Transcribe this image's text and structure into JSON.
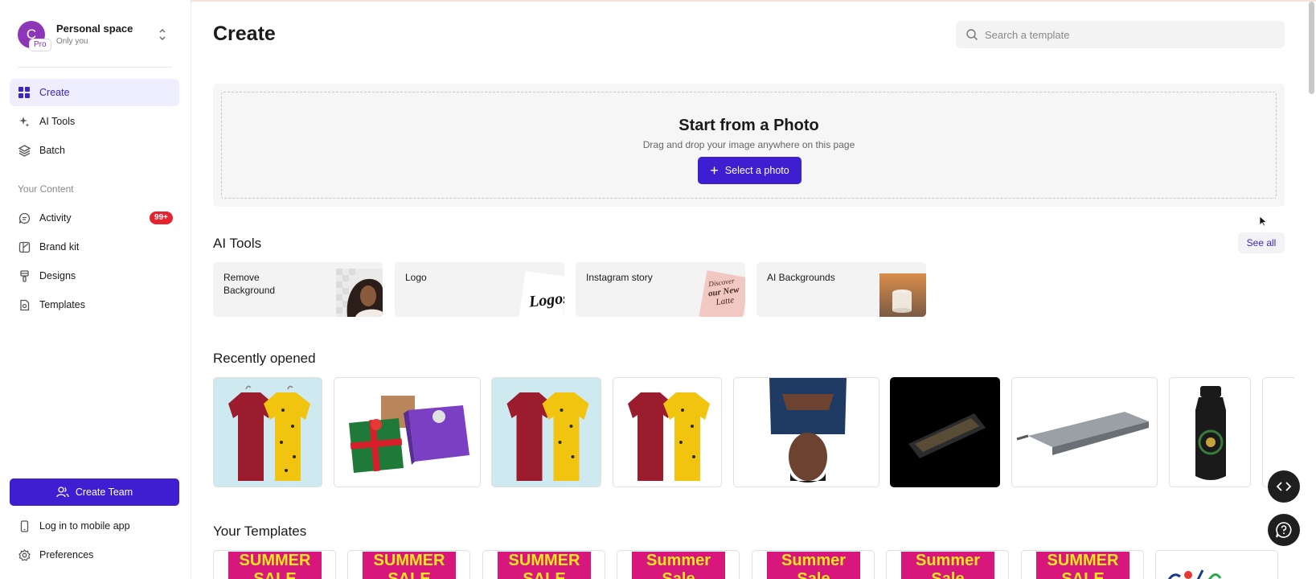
{
  "workspace": {
    "initial": "C",
    "badge": "Pro",
    "name": "Personal space",
    "subtitle": "Only you"
  },
  "sidebar": {
    "items": [
      {
        "label": "Create",
        "icon": "grid-icon"
      },
      {
        "label": "AI Tools",
        "icon": "sparkles-icon"
      },
      {
        "label": "Batch",
        "icon": "layers-icon"
      }
    ],
    "content_label": "Your Content",
    "content_items": [
      {
        "label": "Activity",
        "icon": "chat-icon",
        "badge": "99+"
      },
      {
        "label": "Brand kit",
        "icon": "brand-kit-icon"
      },
      {
        "label": "Designs",
        "icon": "designs-icon"
      },
      {
        "label": "Templates",
        "icon": "template-icon"
      }
    ],
    "create_team": "Create Team",
    "mobile_app": "Log in to mobile app",
    "preferences": "Preferences"
  },
  "header": {
    "title": "Create",
    "search_placeholder": "Search a template"
  },
  "upload": {
    "title": "Start from a Photo",
    "subtitle": "Drag and drop your image anywhere on this page",
    "button": "Select a photo"
  },
  "ai_tools": {
    "heading": "AI Tools",
    "see_all": "See all",
    "cards": [
      "Remove Background",
      "Logo",
      "Instagram story",
      "AI Backgrounds"
    ],
    "thumb_text": {
      "logo": "Logos",
      "story_line1": "Discover",
      "story_line2": "our New",
      "story_line3": "Latte"
    }
  },
  "recently_opened": {
    "heading": "Recently opened",
    "items": [
      "shirts",
      "gift-boxes",
      "shirts",
      "shirts",
      "man-photo",
      "pen-case",
      "usb-hub",
      "bottle",
      "partial"
    ]
  },
  "your_templates": {
    "heading": "Your Templates",
    "items": [
      "SUMMER SALE",
      "SUMMER SALE",
      "SUMMER SALE",
      "Summer Sale",
      "Summer Sale",
      "Summer Sale",
      "SUMMER SALE"
    ]
  },
  "colors": {
    "accent": "#3d1fd1",
    "active_bg": "#eeeefe",
    "badge_red": "#e5232f",
    "sale_pink": "#d8177c",
    "sale_yellow": "#f8e71c"
  }
}
